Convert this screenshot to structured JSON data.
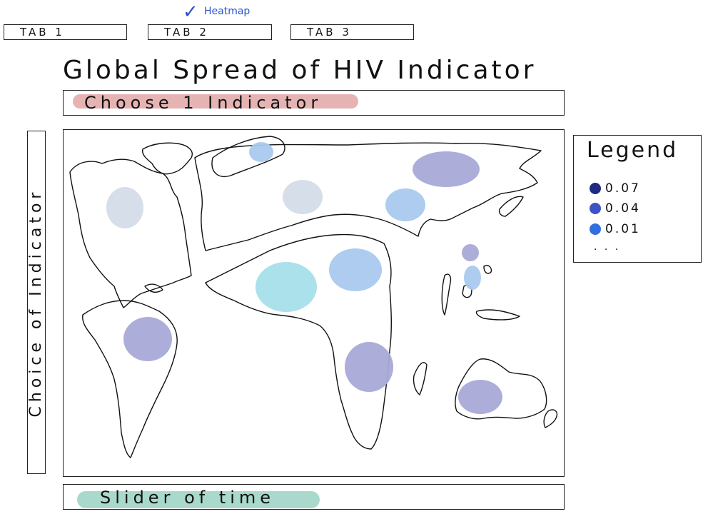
{
  "tabs": [
    {
      "label": "TAB 1"
    },
    {
      "label": "TAB 2"
    },
    {
      "label": "TAB 3"
    }
  ],
  "selected_tab_note": {
    "check": "✓",
    "label": "Heatmap"
  },
  "title": "Global Spread of HIV Indicator",
  "indicator_selector": {
    "label": "Choose 1 Indicator",
    "color": "#e6b3b3"
  },
  "side_panel": {
    "label": "Choice of Indicator"
  },
  "legend": {
    "title": "Legend",
    "items": [
      {
        "value": "0.07",
        "color": "#1f2a80"
      },
      {
        "value": "0.04",
        "color": "#3d52c4"
      },
      {
        "value": "0.01",
        "color": "#2f6fe0"
      }
    ],
    "more": ". . ."
  },
  "heat_colors": {
    "purple": "#a9a9d8",
    "light_blue": "#a9c9ee",
    "pale": "#d4dce9",
    "cyan": "#a6dfea"
  },
  "slider": {
    "label": "Slider of time",
    "color": "#a9d9cc"
  }
}
